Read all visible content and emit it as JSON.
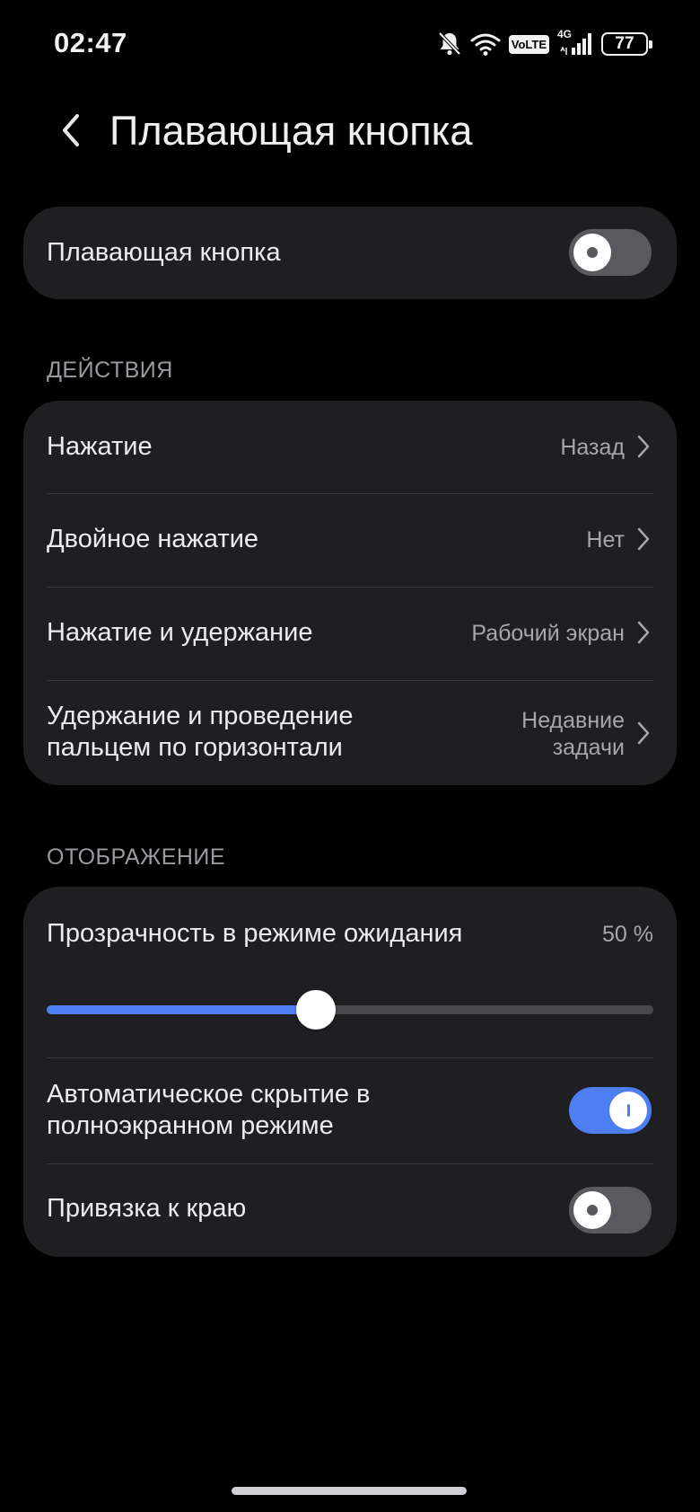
{
  "status_bar": {
    "time": "02:47",
    "network": "4G",
    "volte": "VoLTE",
    "battery": "77",
    "icons": [
      "bell-muted-icon",
      "wifi-icon",
      "volte-icon",
      "signal-icon",
      "battery-icon"
    ]
  },
  "header": {
    "title": "Плавающая кнопка",
    "back_icon": "chevron-left-icon"
  },
  "main_toggle": {
    "label": "Плавающая кнопка",
    "on": false
  },
  "actions": {
    "section_title": "ДЕЙСТВИЯ",
    "items": [
      {
        "label": "Нажатие",
        "value": "Назад"
      },
      {
        "label": "Двойное нажатие",
        "value": "Нет"
      },
      {
        "label": "Нажатие и удержание",
        "value": "Рабочий экран"
      },
      {
        "label": "Удержание и проведение пальцем по горизонтали",
        "value": "Недавние задачи"
      }
    ]
  },
  "display": {
    "section_title": "ОТОБРАЖЕНИЕ",
    "transparency": {
      "label": "Прозрачность в режиме ожидания",
      "value_text": "50 %",
      "value": 0.5
    },
    "auto_hide": {
      "label": "Автоматическое скрытие в полноэкранном режиме",
      "on": true
    },
    "edge_snap": {
      "label": "Привязка к краю",
      "on": false
    }
  },
  "colors": {
    "accent": "#4e7ff2",
    "card": "#1f1f22",
    "background": "#000000"
  }
}
